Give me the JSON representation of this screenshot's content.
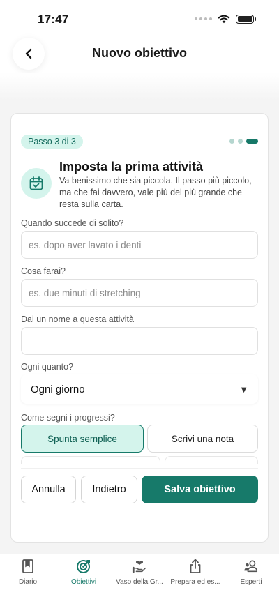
{
  "status": {
    "time": "17:47"
  },
  "header": {
    "title": "Nuovo obiettivo"
  },
  "wizard": {
    "step_label": "Passo 3 di 3",
    "steps_total": 3,
    "current_step": 3
  },
  "intro": {
    "title": "Imposta la prima attività",
    "description": "Va benissimo che sia piccola. Il passo più piccolo, ma che fai davvero, vale più del più grande che resta sulla carta."
  },
  "fields": {
    "when": {
      "label": "Quando succede di solito?",
      "placeholder": "es. dopo aver lavato i denti",
      "value": ""
    },
    "what": {
      "label": "Cosa farai?",
      "placeholder": "es. due minuti di stretching",
      "value": ""
    },
    "name": {
      "label": "Dai un nome a questa attività",
      "placeholder": "",
      "value": ""
    },
    "frequency": {
      "label": "Ogni quanto?",
      "selected": "Ogni giorno"
    },
    "tracking": {
      "label": "Come segni i progressi?",
      "options": [
        "Spunta semplice",
        "Scrivi una nota"
      ],
      "selected": "Spunta semplice"
    }
  },
  "actions": {
    "cancel": "Annulla",
    "back": "Indietro",
    "save": "Salva obiettivo"
  },
  "tabs": [
    {
      "label": "Diario",
      "icon": "book-icon",
      "active": false
    },
    {
      "label": "Obiettivi",
      "icon": "target-icon",
      "active": true
    },
    {
      "label": "Vaso della Gr...",
      "icon": "heart-hand-icon",
      "active": false
    },
    {
      "label": "Prepara ed es...",
      "icon": "share-icon",
      "active": false
    },
    {
      "label": "Esperti",
      "icon": "people-icon",
      "active": false
    }
  ],
  "colors": {
    "accent": "#177a6a",
    "accent_light": "#d4f4ec"
  }
}
